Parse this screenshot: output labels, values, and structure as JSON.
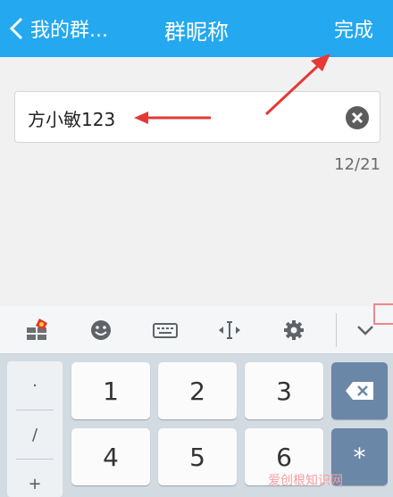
{
  "navbar": {
    "back_label": "我的群...",
    "title": "群昵称",
    "done_label": "完成"
  },
  "name_field": {
    "value": "方小敏123"
  },
  "char_counter": "12/21",
  "keyboard": {
    "toolbar_icons": [
      "gift-icon",
      "emoji-icon",
      "keyboard-icon",
      "cursor-move-icon",
      "gear-icon",
      "collapse-icon"
    ],
    "symbol_keys": [
      "·",
      "/",
      "+"
    ],
    "keys": [
      "1",
      "2",
      "3",
      "4",
      "5",
      "6"
    ],
    "right_keys": [
      "backspace-icon",
      "*"
    ]
  },
  "watermark": "爱创根知识网",
  "colors": {
    "navbar": "#24a8f0",
    "annotation_arrow": "#e53935",
    "dark_key": "#6b87a8"
  }
}
